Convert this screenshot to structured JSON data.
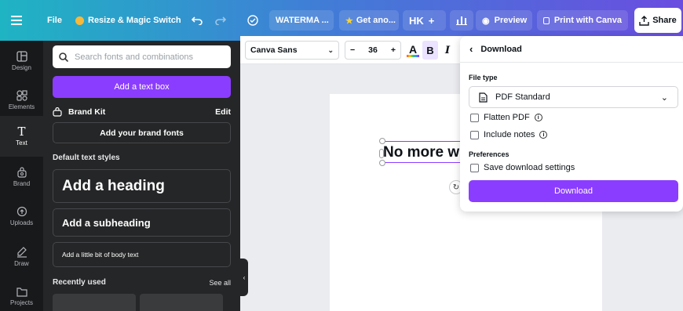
{
  "topbar": {
    "menu_icon": "hamburger-icon",
    "file_label": "File",
    "resize_label": "Resize & Magic Switch",
    "doc_title": "WATERMA ...",
    "get_another_label": "Get ano...",
    "avatar_initials": "HK",
    "preview_label": "Preview",
    "print_label": "Print with Canva",
    "share_label": "Share"
  },
  "rail": {
    "items": [
      {
        "label": "Design",
        "icon": "layout-icon"
      },
      {
        "label": "Elements",
        "icon": "shapes-icon"
      },
      {
        "label": "Text",
        "icon": "text-icon"
      },
      {
        "label": "Brand",
        "icon": "brand-icon"
      },
      {
        "label": "Uploads",
        "icon": "cloud-upload-icon"
      },
      {
        "label": "Draw",
        "icon": "pen-icon"
      },
      {
        "label": "Projects",
        "icon": "folder-icon"
      }
    ]
  },
  "panel": {
    "search_placeholder": "Search fonts and combinations",
    "add_text_box": "Add a text box",
    "brand_kit_label": "Brand Kit",
    "brand_kit_edit": "Edit",
    "add_brand_fonts": "Add your brand fonts",
    "default_styles_label": "Default text styles",
    "heading": "Add a heading",
    "subheading": "Add a subheading",
    "body": "Add a little bit of body text",
    "recently_used": "Recently used",
    "see_all": "See all"
  },
  "toolbar": {
    "font_name": "Canva Sans",
    "font_size": "36",
    "minus": "−",
    "plus": "+",
    "text_color_letter": "A",
    "bold": "B",
    "italic": "I"
  },
  "canvas": {
    "heading_text": "No more w"
  },
  "download": {
    "title": "Download",
    "file_type_label": "File type",
    "file_type_value": "PDF Standard",
    "flatten_pdf": "Flatten PDF",
    "include_notes": "Include notes",
    "preferences_label": "Preferences",
    "save_settings": "Save download settings",
    "download_button": "Download"
  },
  "colors": {
    "accent": "#8b3dff",
    "panel_bg": "#252627",
    "rail_bg": "#18191b"
  }
}
